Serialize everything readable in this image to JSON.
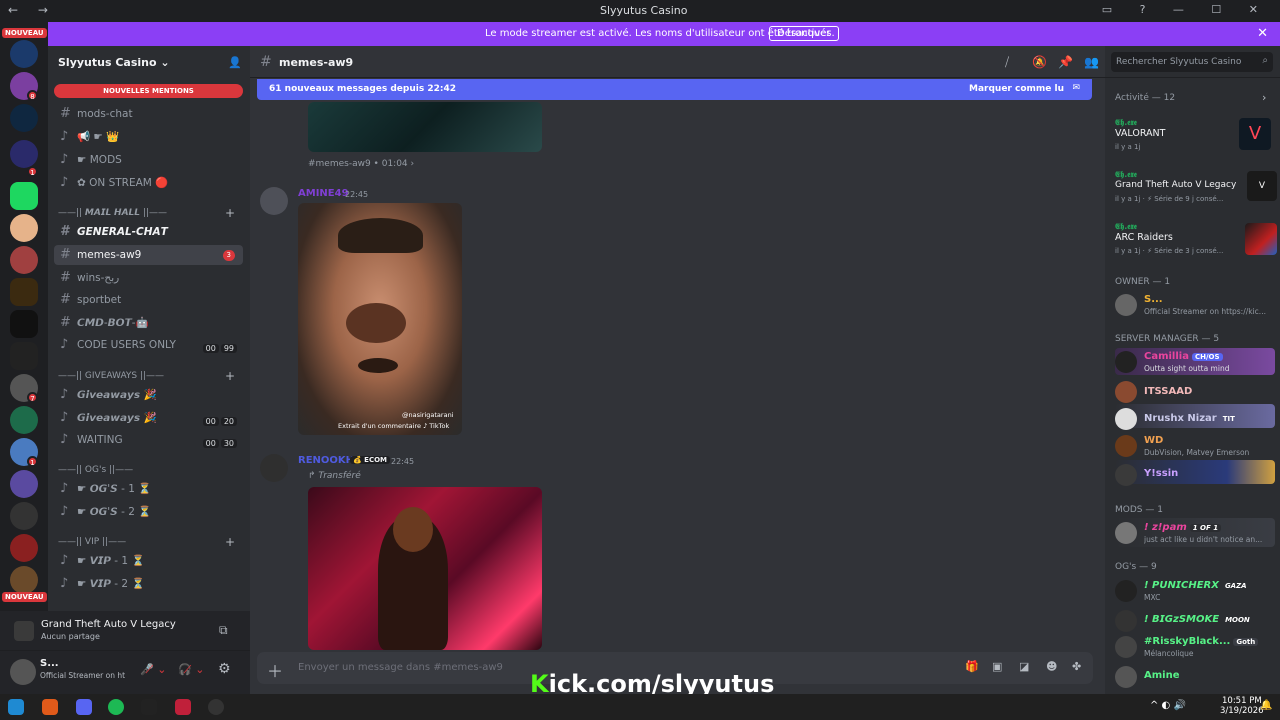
{
  "window": {
    "title": "Slyyutus Casino"
  },
  "banner": {
    "text": "Le mode streamer est activé. Les noms d'utilisateur ont été tronqués.",
    "button": "Désactiver"
  },
  "servers": {
    "badge_top": "NOUVEAU",
    "badge_bottom": "NOUVEAU",
    "unread": [
      "8",
      "1",
      "7",
      "1"
    ]
  },
  "sidebar": {
    "server_name": "Slyyutus Casino",
    "mentions": "NOUVELLES MENTIONS",
    "channels": [
      {
        "label": "mods-chat"
      },
      {
        "label": "📢 ☛ 👑"
      },
      {
        "label": "☛ MODS"
      },
      {
        "label": "✿ ON STREAM 🔴"
      },
      {
        "label": "——|| 𝙈𝘼𝙄𝙇 𝙃𝘼𝙇𝙇 ||——"
      },
      {
        "label": "𝙂𝙀𝙉𝙀𝙍𝘼𝙇-𝘾𝙃𝘼𝙏"
      },
      {
        "label": "memes-aw9",
        "count": "3"
      },
      {
        "label": "wins-ربح"
      },
      {
        "label": "sportbet"
      },
      {
        "label": "𝘾𝙈𝘿-𝘽𝙊𝙏-🤖"
      },
      {
        "label": "CODE USERS ONLY",
        "uc1": "00",
        "uc2": "99"
      },
      {
        "label": "——|| GIVEAWAYS ||——"
      },
      {
        "label": "𝙂𝙞𝙫𝙚𝙖𝙬𝙖𝙮𝙨 🎉"
      },
      {
        "label": "𝙂𝙞𝙫𝙚𝙖𝙬𝙖𝙮𝙨 🎉",
        "uc1": "00",
        "uc2": "20"
      },
      {
        "label": "WAITING",
        "uc1": "00",
        "uc2": "30"
      },
      {
        "label": "——|| OG's ||——"
      },
      {
        "label": "☛ 𝙊𝙂'𝙎 - 1 ⏳"
      },
      {
        "label": "☛ 𝙊𝙂'𝙎 - 2 ⏳"
      },
      {
        "label": "——|| VIP ||——"
      },
      {
        "label": "☛ 𝙑𝙄𝙋 - 1 ⏳"
      },
      {
        "label": "☛ 𝙑𝙄𝙋 - 2 ⏳"
      }
    ]
  },
  "activity": {
    "game": "Grand Theft Auto V Legacy",
    "status": "Aucun partage"
  },
  "user": {
    "name": "S...",
    "status": "Official Streamer on ht"
  },
  "chat": {
    "channel": "memes-aw9",
    "new_messages": "61 nouveaux messages depuis 22:42",
    "mark_read": "Marquer comme lu",
    "prev_ref": "#memes-aw9 • 01:04 ›",
    "msg1": {
      "author": "AMINE49",
      "time": "22:45",
      "watermark": "@nasirigatarani",
      "caption": "Extrait d'un commentaire ♪ TikTok"
    },
    "msg2": {
      "author": "RENOOKH",
      "tag": "ECOM",
      "time": "22:45",
      "forwarded": "Transféré"
    },
    "composer_placeholder": "Envoyer un message dans #memes-aw9"
  },
  "members": {
    "search_placeholder": "Rechercher Slyyutus Casino",
    "activity_header": "Activité — 12",
    "activity": [
      {
        "name": "𝕰𝖍.𝖊𝖝𝖊",
        "game": "VALORANT",
        "sub": "il y a 1j"
      },
      {
        "name": "𝕰𝖍.𝖊𝖝𝖊",
        "game": "Grand Theft Auto V Legacy",
        "sub": "il y a 1j · ⚡ Série de 9 j consé..."
      },
      {
        "name": "𝕰𝖍.𝖊𝖝𝖊",
        "game": "ARC Raiders",
        "sub": "il y a 1j · ⚡ Série de 3 j consé..."
      }
    ],
    "owner_header": "OWNER — 1",
    "owner": [
      {
        "name": "S...",
        "sub": "Official Streamer on https://kic..."
      }
    ],
    "manager_header": "SERVER MANAGER — 5",
    "managers": [
      {
        "name": "Camillia",
        "tag": "CH/OS",
        "sub": "Outta sight outta mind"
      },
      {
        "name": "ITSSAAD",
        "sub": ""
      },
      {
        "name": "Nrushx Nizar",
        "tag": "TIT",
        "sub": ""
      },
      {
        "name": "WD",
        "sub": "DubVision, Matvey Emerson"
      },
      {
        "name": "Y!ssin",
        "sub": ""
      }
    ],
    "mods_header": "MODS — 1",
    "mods": [
      {
        "name": "! z!pam",
        "tag": "1 OF 1",
        "sub": "just act like u didn't notice an..."
      }
    ],
    "og_header": "OG's — 9",
    "ogs": [
      {
        "name": "! 𝙋𝙐𝙉𝙄𝘾𝙃𝙀𝙍𝙓",
        "tag": "GAZA",
        "sub": "MXC"
      },
      {
        "name": "! 𝘽𝙄𝙂𝙯𝙎𝙈𝙊𝙆𝙀",
        "tag": "MOON",
        "sub": ""
      },
      {
        "name": "#RisskyBlack...",
        "tag": "Goth",
        "sub": "Mélancolique"
      },
      {
        "name": "Amine",
        "sub": ""
      }
    ]
  },
  "taskbar": {
    "time": "10:51 PM",
    "date": "3/19/2026"
  },
  "overlay": {
    "kick": "ick.com/slyyutus"
  },
  "colors": {
    "blurple": "#5865f2",
    "banner": "#8b3ff5",
    "red": "#da373c",
    "green": "#23a55a"
  }
}
